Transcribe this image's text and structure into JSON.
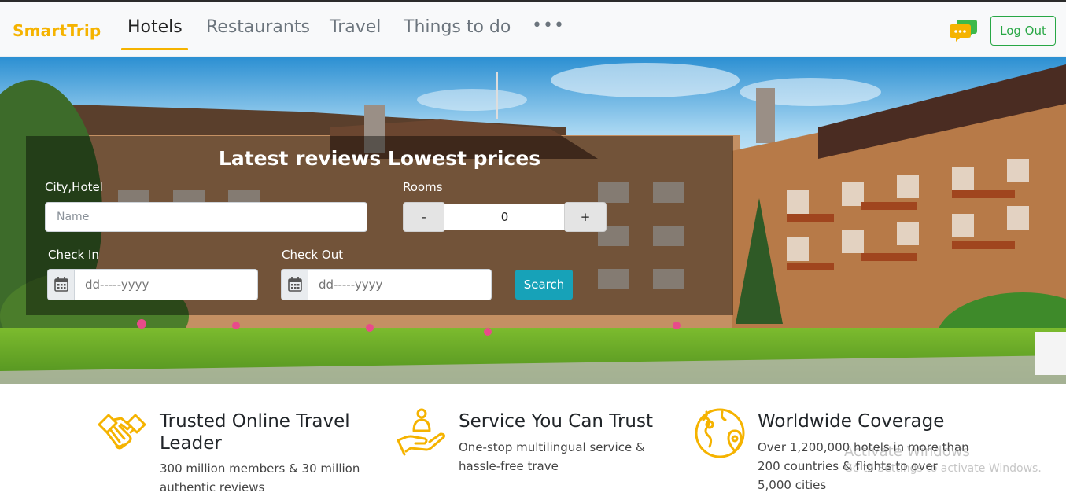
{
  "brand": "SmartTrip",
  "nav": {
    "items": [
      {
        "label": "Hotels",
        "active": true
      },
      {
        "label": "Restaurants",
        "active": false
      },
      {
        "label": "Travel",
        "active": false
      },
      {
        "label": "Things to do",
        "active": false
      }
    ],
    "more": "•••",
    "logout_label": "Log Out"
  },
  "search": {
    "title": "Latest reviews Lowest prices",
    "city_label": "City,Hotel",
    "city_placeholder": "Name",
    "rooms_label": "Rooms",
    "rooms_minus": "-",
    "rooms_value": "0",
    "rooms_plus": "+",
    "checkin_label": "Check In",
    "checkin_placeholder": "dd-----yyyy",
    "checkout_label": "Check Out",
    "checkout_placeholder": "dd-----yyyy",
    "search_label": "Search"
  },
  "features": [
    {
      "icon": "handshake-icon",
      "title": "Trusted Online Travel Leader",
      "description": "300 million members & 30 million authentic reviews"
    },
    {
      "icon": "service-hand-icon",
      "title": "Service You Can Trust",
      "description": "One-stop multilingual service & hassle-free trave"
    },
    {
      "icon": "globe-location-icon",
      "title": "Worldwide Coverage",
      "description": "Over 1,200,000 hotels in more than 200 countries & flights to over 5,000 cities"
    }
  ],
  "watermark": {
    "line1": "Activate Windows",
    "line2": "Go to Settings to activate Windows."
  },
  "colors": {
    "brand": "#f5b300",
    "logout": "#28a745",
    "search_button": "#17a2b8",
    "icon": "#f5b300"
  }
}
